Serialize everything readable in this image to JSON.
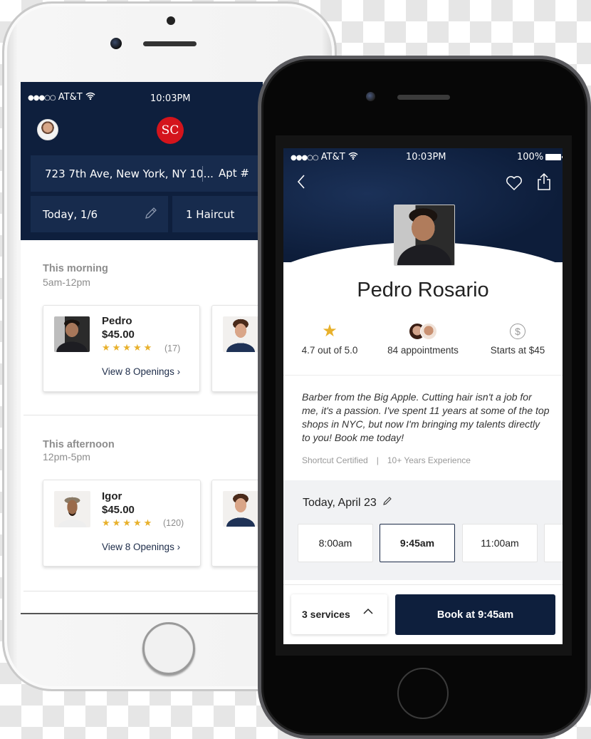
{
  "left_phone": {
    "status_bar": {
      "signal": "●●●○○",
      "carrier": "AT&T",
      "wifi_icon": "wifi-icon",
      "time": "10:03PM"
    },
    "header": {
      "logo_text": "SC",
      "logo_color": "#d4141c",
      "address": "723 7th Ave, New York, NY 10...",
      "apt_placeholder": "Apt #",
      "date": "Today, 1/6",
      "service": "1 Haircut",
      "background": "#0e1f3d"
    },
    "sections": [
      {
        "title": "This morning",
        "hours": "5am-12pm",
        "cards": [
          {
            "name": "Pedro",
            "price": "$45.00",
            "stars": "★★★★★",
            "rating_count": "(17)",
            "link": "View 8 Openings ›"
          }
        ]
      },
      {
        "title": "This afternoon",
        "hours": "12pm-5pm",
        "cards": [
          {
            "name": "Igor",
            "price": "$45.00",
            "stars": "★★★★★",
            "rating_count": "(120)",
            "link": "View 8 Openings ›"
          }
        ]
      }
    ]
  },
  "right_phone": {
    "status_bar": {
      "signal": "●●●○○",
      "carrier": "AT&T",
      "time": "10:03PM",
      "battery": "100%"
    },
    "nav": {
      "back_glyph": "‹"
    },
    "profile": {
      "name": "Pedro Rosario",
      "stats": [
        {
          "icon": "star-icon",
          "label": "4.7 out of 5.0"
        },
        {
          "icon": "client-avatars-icon",
          "label": "84 appointments"
        },
        {
          "icon": "dollar-icon",
          "glyph": "$",
          "label": "Starts at $45"
        }
      ],
      "bio": "Barber from the Big Apple. Cutting hair isn't a job for me, it's a passion. I've spent 11 years at some of the top shops in NYC, but now I'm bringing my talents directly to you! Book me today!",
      "tags": [
        "Shortcut Certified",
        "10+ Years Experience"
      ],
      "tag_separator": "|"
    },
    "schedule": {
      "date": "Today, April 23",
      "slots": [
        {
          "time": "8:00am",
          "selected": false
        },
        {
          "time": "9:45am",
          "selected": true
        },
        {
          "time": "11:00am",
          "selected": false
        },
        {
          "time": "",
          "selected": false
        }
      ]
    },
    "footer": {
      "services_label": "3 services",
      "book_label": "Book at 9:45am",
      "accent": "#0e1f3d"
    }
  }
}
